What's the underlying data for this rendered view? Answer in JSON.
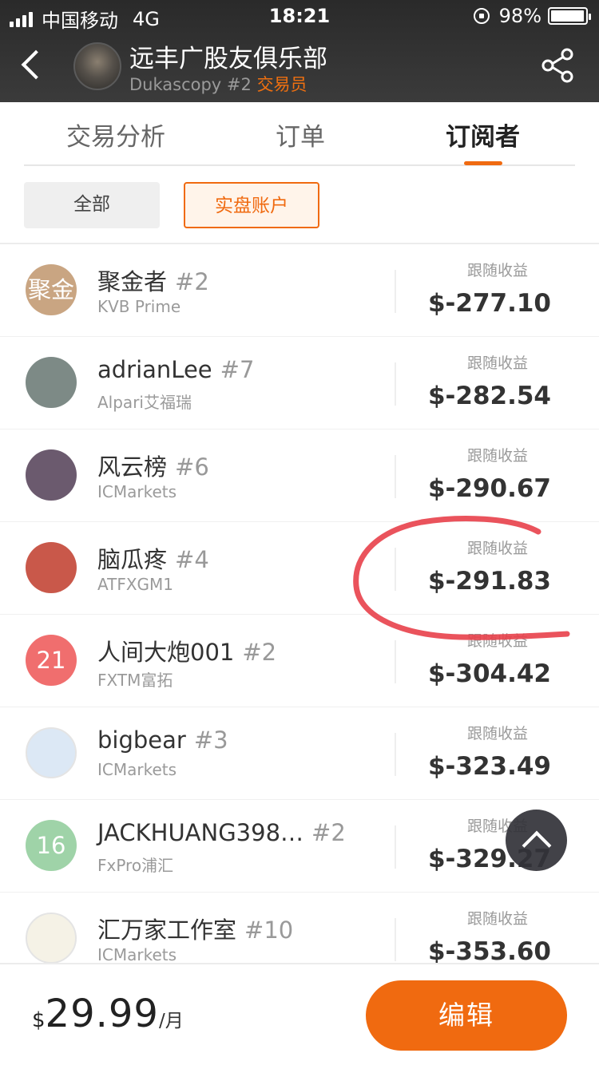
{
  "status_bar": {
    "carrier": "中国移动",
    "network": "4G",
    "time": "18:21",
    "battery_percent": "98%",
    "battery_level": 0.98
  },
  "header": {
    "club_name": "远丰广股友俱乐部",
    "subtitle": "Dukascopy #2",
    "role": "交易员"
  },
  "tabs": [
    {
      "label": "交易分析",
      "active": false
    },
    {
      "label": "订单",
      "active": false
    },
    {
      "label": "订阅者",
      "active": true
    }
  ],
  "filters": [
    {
      "label": "全部",
      "selected": false
    },
    {
      "label": "实盘账户",
      "selected": true
    }
  ],
  "gain_label": "跟随收益",
  "subscribers": [
    {
      "avatar_text": "聚金",
      "avatar_color": "#c9a582",
      "name": "聚金者",
      "rank": "#2",
      "broker": "KVB Prime",
      "gain": "$-277.10"
    },
    {
      "avatar_text": "",
      "avatar_color": "#7d8a86",
      "name": "adrianLee",
      "rank": "#7",
      "broker": "Alpari艾福瑞",
      "gain": "$-282.54"
    },
    {
      "avatar_text": "",
      "avatar_color": "#6b5a6e",
      "name": "风云榜",
      "rank": "#6",
      "broker": "ICMarkets",
      "gain": "$-290.67"
    },
    {
      "avatar_text": "",
      "avatar_color": "#c9584a",
      "name": "脑瓜疼",
      "rank": "#4",
      "broker": "ATFXGM1",
      "gain": "$-291.83"
    },
    {
      "avatar_text": "21",
      "avatar_color": "#f06e6e",
      "name": "人间大炮001",
      "rank": "#2",
      "broker": "FXTM富拓",
      "gain": "$-304.42"
    },
    {
      "avatar_text": "",
      "avatar_color": "#dce8f5",
      "name": "bigbear",
      "rank": "#3",
      "broker": "ICMarkets",
      "gain": "$-323.49"
    },
    {
      "avatar_text": "16",
      "avatar_color": "#9fd3a8",
      "name": "JACKHUANG398…",
      "rank": "#2",
      "broker": "FxPro浦汇",
      "gain": "$-329.27"
    },
    {
      "avatar_text": "",
      "avatar_color": "#f5f2e6",
      "name": "汇万家工作室",
      "rank": "#10",
      "broker": "ICMarkets",
      "gain": "$-353.60"
    }
  ],
  "footer": {
    "currency": "$",
    "amount": "29.99",
    "unit": "/月",
    "edit_label": "编辑"
  },
  "colors": {
    "accent": "#f06a10",
    "annotation": "#e8404a"
  }
}
